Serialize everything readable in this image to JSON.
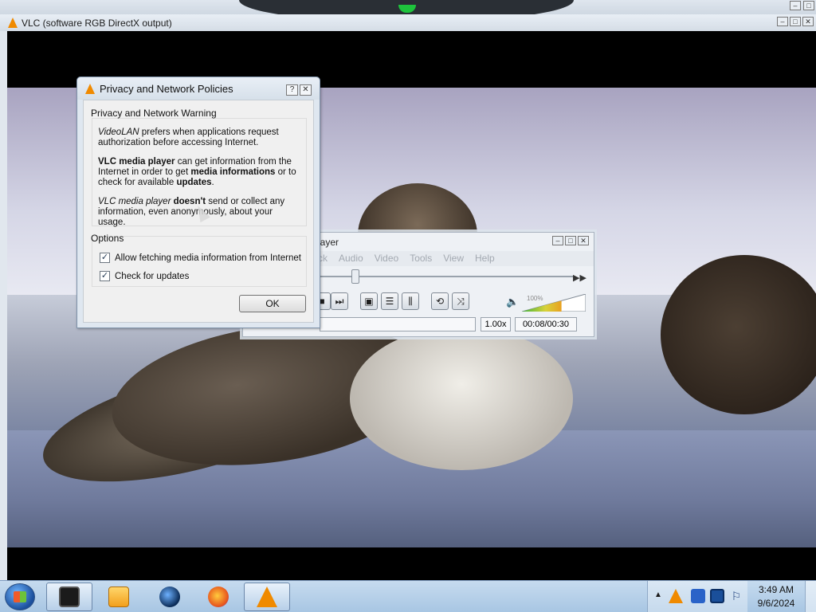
{
  "vlc_output_window": {
    "title": "VLC (software RGB DirectX output)"
  },
  "mini_player": {
    "title_fragment": "layer",
    "menu": [
      "ck",
      "Audio",
      "Video",
      "Tools",
      "View",
      "Help"
    ],
    "volume_label": "100%",
    "speed": "1.00x",
    "time": "00:08/00:30",
    "seek_position": 0.14,
    "volume": 1.0
  },
  "dialog": {
    "title": "Privacy and Network Policies",
    "help_glyph": "?",
    "close_glyph": "✕",
    "warning_section": {
      "title": "Privacy and Network Warning",
      "p1_part1": "VideoLAN",
      "p1_part2": " prefers when applications request authorization before accessing Internet.",
      "p2_part1": "VLC media player",
      "p2_part2": " can get information from the Internet in order to get ",
      "p2_part3": "media informations",
      "p2_part4": " or to check for available ",
      "p2_part5": "updates",
      "p2_part6": ".",
      "p3_part1": "VLC media player",
      "p3_part2": " ",
      "p3_part3": "doesn't",
      "p3_part4": " send or collect any information, even anonymously, about your usage."
    },
    "options_section": {
      "title": "Options",
      "checkbox1": {
        "label": "Allow fetching media information from Internet",
        "checked": true
      },
      "checkbox2": {
        "label": "Check for updates",
        "checked": true
      }
    },
    "ok_label": "OK"
  },
  "taskbar": {
    "clock_time": "3:49 AM",
    "clock_date": "9/6/2024"
  },
  "colors": {
    "vlc_orange": "#f08a00",
    "taskbar": "#b7d0ea",
    "dialog_frame": "#dfe7f0"
  }
}
